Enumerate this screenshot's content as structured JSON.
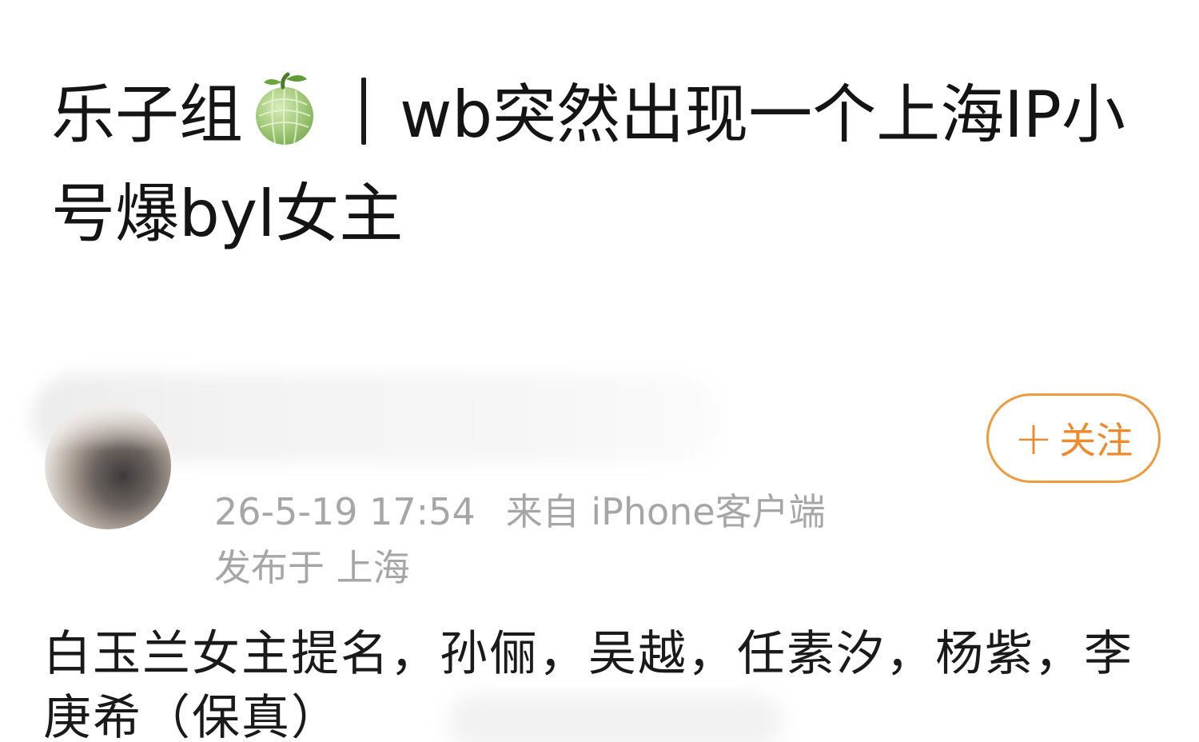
{
  "post": {
    "title_part1": "乐子组",
    "title_emoji": "melon-icon",
    "title_separator": "丨",
    "title_part2": "wb突然出现一个上海IP小号爆byl女主",
    "body": "白玉兰女主提名，孙俪，吴越，任素汐，杨紫，李庚希（保真）"
  },
  "author": {
    "avatar_icon": "avatar",
    "follow_plus": "+",
    "follow_label": "关注",
    "time": "26-5-19 17:54",
    "source": "来自 iPhone客户端",
    "location": "发布于 上海"
  },
  "colors": {
    "accent": "#f0892a",
    "accent_border": "#f09a3e",
    "meta_text": "#a6a6a6",
    "title_text": "#141414",
    "melon_green": "#a3c97a"
  }
}
